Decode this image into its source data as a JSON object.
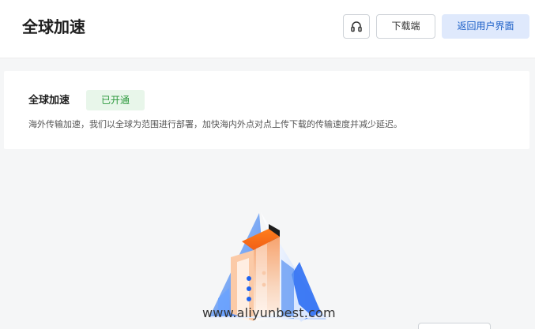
{
  "header": {
    "title": "全球加速",
    "support_icon": "headset-icon",
    "download_label": "下载端",
    "return_label": "返回用户界面"
  },
  "feature_card": {
    "title": "全球加速",
    "status": "已开通",
    "description": "海外传输加速，我们以全球为范围进行部署，加快海内外点对点上传下载的传输速度并减少延迟。"
  },
  "illustration": {
    "icon": "building-illustration"
  },
  "watermark": {
    "text": "www.aliyunbest.com"
  },
  "colors": {
    "primary": "#1b5fc7",
    "primary_light": "#dfe9fc",
    "success": "#2e9a3f",
    "success_light": "#e8f6ea",
    "page_background": "#f5f6f7"
  }
}
